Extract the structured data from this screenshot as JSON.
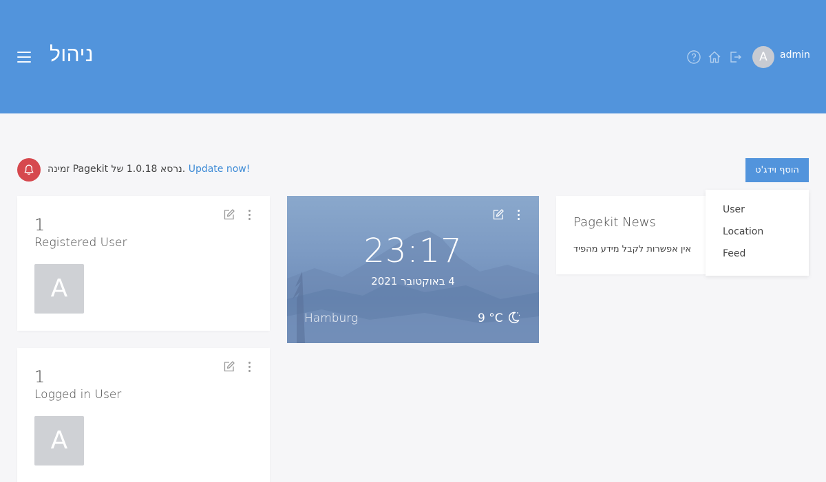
{
  "header": {
    "title": "ניהול",
    "user_avatar_letter": "A",
    "user_name": "admin",
    "icons": [
      "menu-icon",
      "help-icon",
      "home-icon",
      "logout-icon"
    ]
  },
  "notice": {
    "text": "זמינה Pagekit נרסא 1.0.18 של.",
    "link": "Update now!"
  },
  "toolbar": {
    "add_widget_label": "הוסף וידג'ט"
  },
  "add_widget_menu": {
    "items": [
      "User",
      "Location",
      "Feed"
    ]
  },
  "widgets": {
    "registered_users": {
      "count": "1",
      "label": "Registered User",
      "avatar_letter": "A"
    },
    "logged_in_users": {
      "count": "1",
      "label": "Logged in User",
      "avatar_letter": "A"
    },
    "clock": {
      "time": "23:17",
      "date": "4 באוקטובר 2021",
      "city": "Hamburg",
      "temperature": "9 °C"
    },
    "news": {
      "title": "Pagekit News",
      "message": "אין אפשרות לקבל מידע מהפיד"
    }
  },
  "colors": {
    "header_bg": "#5294dc",
    "page_bg": "#f6f6f8",
    "notice_badge": "#d6484e",
    "link": "#3e8bd6"
  }
}
